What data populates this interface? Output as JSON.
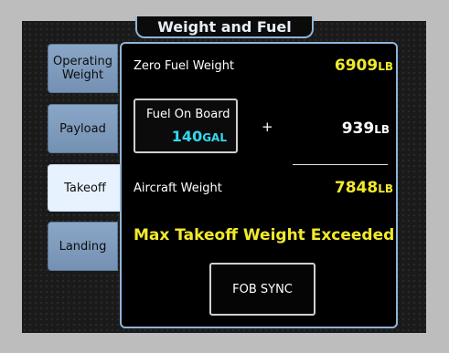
{
  "window": {
    "title": "Weight and Fuel"
  },
  "tabs": [
    {
      "label": "Operating Weight",
      "active": false
    },
    {
      "label": "Payload",
      "active": false
    },
    {
      "label": "Takeoff",
      "active": true
    },
    {
      "label": "Landing",
      "active": false
    }
  ],
  "takeoff": {
    "zero_fuel_weight": {
      "label": "Zero Fuel Weight",
      "value": "6909",
      "unit": "LB"
    },
    "fuel_on_board": {
      "label": "Fuel On Board",
      "value": "140",
      "unit": "GAL"
    },
    "operator": "+",
    "fuel_weight": {
      "value": "939",
      "unit": "LB"
    },
    "aircraft_weight": {
      "label": "Aircraft Weight",
      "value": "7848",
      "unit": "LB"
    },
    "warning": "Max Takeoff Weight Exceeded",
    "sync_button": "FOB SYNC"
  },
  "colors": {
    "accent_border": "#8fb4d8",
    "value_yellow": "#f1ea2b",
    "value_cyan": "#33d9ef",
    "tab_bg": "#7f9dc0",
    "tab_active_bg": "#e8f2ff"
  }
}
